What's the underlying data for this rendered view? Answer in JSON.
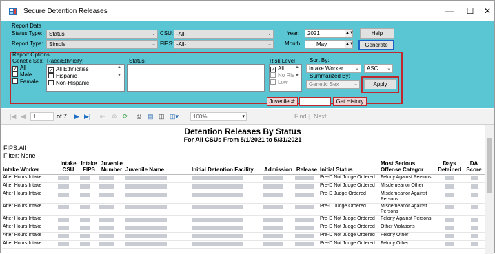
{
  "window": {
    "title": "Secure Detention Releases",
    "minimize": "—",
    "maximize": "☐",
    "close": "✕"
  },
  "report_data": {
    "group_label": "Report Data",
    "status_type_label": "Status Type:",
    "status_type_value": "Status",
    "report_type_label": "Report Type:",
    "report_type_value": "Simple",
    "csu_label": "CSU:",
    "csu_value": "-All-",
    "fips_label": "FIPS:",
    "fips_value": "-All-",
    "year_label": "Year:",
    "year_value": "2021",
    "month_label": "Month:",
    "month_value": "May",
    "help_button": "Help",
    "generate_button": "Generate"
  },
  "report_options": {
    "group_label": "Report Options",
    "genetic_sex_label": "Genetic Sex:",
    "genetic_sex_items": [
      {
        "label": "All",
        "checked": true
      },
      {
        "label": "Male",
        "checked": false
      },
      {
        "label": "Female",
        "checked": false
      }
    ],
    "race_label": "Race/Ethnicity:",
    "race_items": [
      {
        "label": "All Ethnicities",
        "checked": true
      },
      {
        "label": "Hispanic",
        "checked": false
      },
      {
        "label": "Non-Hispanic",
        "checked": false
      }
    ],
    "status_label": "Status:",
    "risk_label": "Risk Level",
    "risk_items": [
      {
        "label": "All",
        "checked": true
      },
      {
        "label": "No Risk",
        "checked": false
      },
      {
        "label": "Low",
        "checked": false
      }
    ],
    "sort_by_label": "Sort By:",
    "sort_by_value": "Intake Worker",
    "sort_dir_value": "ASC",
    "summarized_by_label": "Summarized By:",
    "summarized_by_value": "Genetic Sex",
    "apply_button": "Apply",
    "juvenile_label": "Juvenile #:",
    "juvenile_value": "",
    "get_history_button": "Get History"
  },
  "toolbar": {
    "page_current": "1",
    "page_total": "of 7",
    "zoom": "100%",
    "find_label": "Find",
    "next_label": "Next"
  },
  "report": {
    "title": "Detention Releases By Status",
    "subtitle": "For All CSUs From 5/1/2021 to 5/31/2021",
    "fips_line": "FIPS:All",
    "filter_line": "Filter: None",
    "columns": [
      "Intake Worker",
      "Intake CSU",
      "Intake FIPS",
      "Juvenile Number",
      "Juvenile Name",
      "Initial Detention Facility",
      "Admission",
      "Release",
      "Initial Status",
      "Most Serious Offense Categor",
      "Days Detained",
      "DA Score"
    ],
    "rows": [
      {
        "worker": "After Hours Intake",
        "status": "Pre-D Not Judge Ordered",
        "offense": "Felony Against Persons",
        "tall": false
      },
      {
        "worker": "After Hours Intake",
        "status": "Pre-D Not Judge Ordered",
        "offense": "Misdemeanor Other",
        "tall": false
      },
      {
        "worker": "After Hours Intake",
        "status": "Pre-D Judge Ordered",
        "offense": "Misdemeanor Against Persons",
        "tall": true
      },
      {
        "worker": "After Hours Intake",
        "status": "Pre-D Judge Ordered",
        "offense": "Misdemeanor Against Persons",
        "tall": true
      },
      {
        "worker": "After Hours Intake",
        "status": "Pre-D Not Judge Ordered",
        "offense": "Felony Against Persons",
        "tall": false
      },
      {
        "worker": "After Hours Intake",
        "status": "Pre-D Not Judge Ordered",
        "offense": "Other Violations",
        "tall": false
      },
      {
        "worker": "After Hours Intake",
        "status": "Pre-D Not Judge Ordered",
        "offense": "Felony Other",
        "tall": false
      },
      {
        "worker": "After Hours Intake",
        "status": "Pre-D Not Judge Ordered",
        "offense": "Felony Other",
        "tall": false
      }
    ]
  },
  "colors": {
    "panel": "#5ac6d3",
    "highlight": "#c0282e",
    "generate_border": "#1b63c6"
  }
}
